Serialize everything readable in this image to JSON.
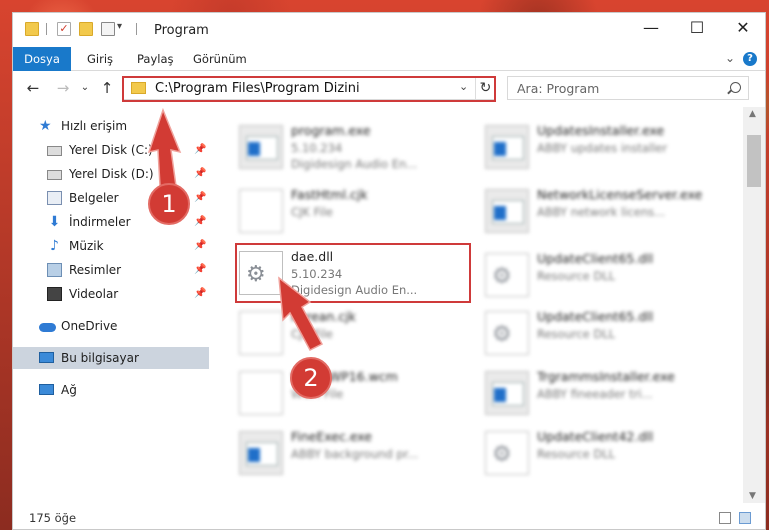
{
  "window": {
    "title": "Program",
    "controls": {
      "minimize": "—",
      "maximize": "☐",
      "close": "✕"
    }
  },
  "ribbon": {
    "tabs": [
      "Dosya",
      "Giriş",
      "Paylaş",
      "Görünüm"
    ],
    "active_tab": "Dosya",
    "help": "?",
    "expand": "⌄"
  },
  "address": {
    "path": "C:\\Program Files\\Program Dizini",
    "dropdown": "⌄",
    "refresh": "↻"
  },
  "search": {
    "placeholder": "Ara: Program"
  },
  "nav_buttons": {
    "back": "←",
    "forward": "→",
    "recent": "⌄",
    "up": "↑"
  },
  "sidebar": {
    "quick_access": "Hızlı erişim",
    "items": [
      {
        "label": "Yerel Disk (C:)",
        "icon": "drive-icon",
        "pinned": true
      },
      {
        "label": "Yerel Disk (D:)",
        "icon": "drive-icon",
        "pinned": true
      },
      {
        "label": "Belgeler",
        "icon": "documents-icon",
        "pinned": true
      },
      {
        "label": "İndirmeler",
        "icon": "downloads-icon",
        "pinned": true
      },
      {
        "label": "Müzik",
        "icon": "music-icon",
        "pinned": true
      },
      {
        "label": "Resimler",
        "icon": "pictures-icon",
        "pinned": true
      },
      {
        "label": "Videolar",
        "icon": "videos-icon",
        "pinned": true
      }
    ],
    "onedrive": "OneDrive",
    "this_pc": "Bu bilgisayar",
    "network": "Ağ",
    "pin_glyph": "📌"
  },
  "files": [
    {
      "name": "program.exe",
      "line2": "5.10.234",
      "line3": "Digidesign Audio En...",
      "icon": "exe-icon",
      "blurred": true
    },
    {
      "name": "UpdatesInstaller.exe",
      "line2": "ABBY updates installer",
      "line3": "",
      "icon": "exe-icon",
      "blurred": true
    },
    {
      "name": "FastHtml.cjk",
      "line2": "CJK File",
      "line3": "",
      "icon": "file-icon",
      "blurred": true
    },
    {
      "name": "NetworkLicenseServer.exe",
      "line2": "ABBY network licens...",
      "line3": "",
      "icon": "exe-icon",
      "blurred": true
    },
    {
      "name": "dae.dll",
      "line2": "5.10.234",
      "line3": "Digidesign Audio En...",
      "icon": "dll-gear-icon",
      "blurred": false
    },
    {
      "name": "UpdateClient65.dll",
      "line2": "Resource DLL",
      "line3": "",
      "icon": "dll-gear-icon",
      "blurred": true
    },
    {
      "name": "Korean.cjk",
      "line2": "CJK File",
      "line3": "",
      "icon": "file-icon",
      "blurred": true
    },
    {
      "name": "UpdateClient65.dll",
      "line2": "Resource DLL",
      "line3": "",
      "icon": "dll-gear-icon",
      "blurred": true
    },
    {
      "name": "SmartWP16.wcm",
      "line2": "WCM File",
      "line3": "",
      "icon": "file-icon",
      "blurred": true
    },
    {
      "name": "TrgrammsInstaller.exe",
      "line2": "ABBY fineeader tri...",
      "line3": "",
      "icon": "exe-icon",
      "blurred": true
    },
    {
      "name": "FineExec.exe",
      "line2": "ABBY background pr...",
      "line3": "",
      "icon": "exe-icon",
      "blurred": true
    },
    {
      "name": "UpdateClient42.dll",
      "line2": "Resource DLL",
      "line3": "",
      "icon": "dll-gear-icon",
      "blurred": true
    }
  ],
  "status": {
    "item_count": "175 öğe"
  },
  "annotations": {
    "step1": "1",
    "step2": "2",
    "color": "#d23b34"
  }
}
